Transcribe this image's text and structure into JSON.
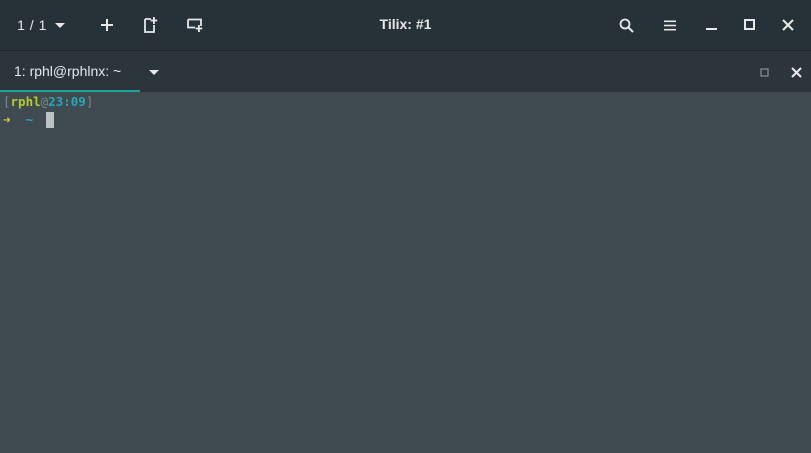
{
  "window": {
    "title": "Tilix: #1"
  },
  "header": {
    "session_count": "1 / 1"
  },
  "terminal_tab": {
    "label": "1: rphl@rphlnx: ~"
  },
  "terminal": {
    "prompt_open": "[",
    "user": "rphl",
    "at": "@",
    "time": "23:09",
    "prompt_close": "]",
    "arrow": "➜",
    "cwd": "~"
  },
  "colors": {
    "headerbar_bg": "#263238",
    "termbar_bg": "#2b353a",
    "terminal_bg": "#404b51",
    "tab_accent": "#1aa69a",
    "user_color": "#b6cc27",
    "time_color": "#2aa6b3",
    "arrow_color": "#d8d13a"
  },
  "icons": {
    "session_switch": "chevron-down-icon",
    "add": "plus-icon",
    "detach": "add-session-icon",
    "sync": "sync-input-icon",
    "search": "search-icon",
    "menu": "hamburger-menu-icon",
    "minimize": "minimize-icon",
    "maximize": "maximize-icon",
    "close": "close-icon"
  }
}
